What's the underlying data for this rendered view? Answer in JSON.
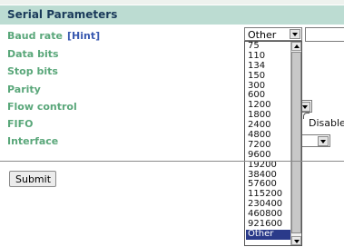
{
  "section": {
    "title": "Serial Parameters"
  },
  "params": [
    {
      "label": "Baud rate"
    },
    {
      "label": "Data bits"
    },
    {
      "label": "Stop bits"
    },
    {
      "label": "Parity"
    },
    {
      "label": "Flow control"
    },
    {
      "label": "FIFO"
    },
    {
      "label": "Interface"
    }
  ],
  "hint": {
    "label": "[Hint]"
  },
  "baud_select": {
    "value": "Other",
    "options": [
      "75",
      "110",
      "134",
      "150",
      "300",
      "600",
      "1200",
      "1800",
      "2400",
      "4800",
      "7200",
      "9600",
      "19200",
      "38400",
      "57600",
      "115200",
      "230400",
      "460800",
      "921600",
      "Other"
    ],
    "selected": "Other"
  },
  "fifo": {
    "option_label": "Disable"
  },
  "submit": {
    "label": "Submit"
  },
  "colors": {
    "header_bg": "#bcdcd2",
    "label_green": "#5aa77a",
    "hint_blue": "#3a5ab0",
    "selected_bg": "#2a3a8a"
  }
}
